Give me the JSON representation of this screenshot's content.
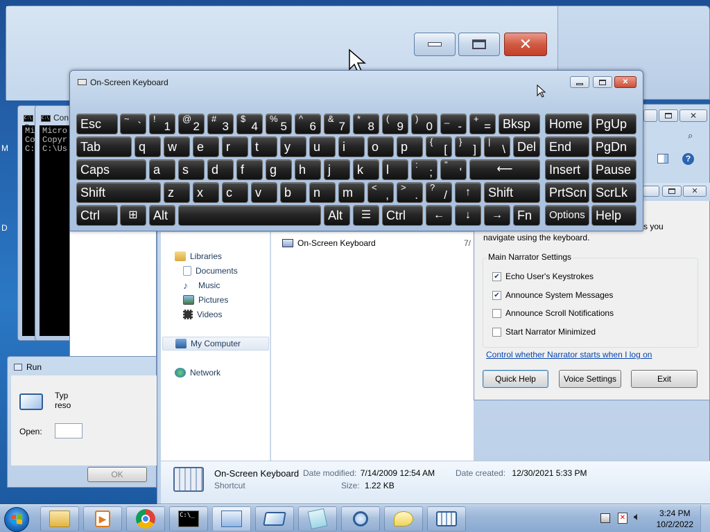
{
  "cmd_windows": [
    {
      "title": "Co",
      "lines": [
        "Mi",
        "Co",
        "",
        "C:"
      ]
    },
    {
      "title": "Con",
      "lines": [
        "Micro",
        "Copyr",
        "",
        "C:\\Us"
      ]
    }
  ],
  "on_screen_keyboard": {
    "title": "On-Screen Keyboard",
    "row1": [
      {
        "label": "Esc"
      },
      {
        "shift": "~",
        "base": "`"
      },
      {
        "shift": "!",
        "base": "1"
      },
      {
        "shift": "@",
        "base": "2"
      },
      {
        "shift": "#",
        "base": "3"
      },
      {
        "shift": "$",
        "base": "4"
      },
      {
        "shift": "%",
        "base": "5"
      },
      {
        "shift": "^",
        "base": "6"
      },
      {
        "shift": "&",
        "base": "7"
      },
      {
        "shift": "*",
        "base": "8"
      },
      {
        "shift": "(",
        "base": "9"
      },
      {
        "shift": ")",
        "base": "0"
      },
      {
        "shift": "_",
        "base": "-"
      },
      {
        "shift": "+",
        "base": "="
      },
      {
        "label": "Bksp"
      },
      {
        "label": "Home"
      },
      {
        "label": "PgUp"
      }
    ],
    "row2": [
      {
        "label": "Tab"
      },
      {
        "label": "q"
      },
      {
        "label": "w"
      },
      {
        "label": "e"
      },
      {
        "label": "r"
      },
      {
        "label": "t"
      },
      {
        "label": "y"
      },
      {
        "label": "u"
      },
      {
        "label": "i"
      },
      {
        "label": "o"
      },
      {
        "label": "p"
      },
      {
        "shift": "{",
        "base": "["
      },
      {
        "shift": "}",
        "base": "]"
      },
      {
        "shift": "|",
        "base": "\\"
      },
      {
        "label": "Del"
      },
      {
        "label": "End"
      },
      {
        "label": "PgDn"
      }
    ],
    "row3": [
      {
        "label": "Caps"
      },
      {
        "label": "a"
      },
      {
        "label": "s"
      },
      {
        "label": "d"
      },
      {
        "label": "f"
      },
      {
        "label": "g"
      },
      {
        "label": "h"
      },
      {
        "label": "j"
      },
      {
        "label": "k"
      },
      {
        "label": "l"
      },
      {
        "shift": ":",
        "base": ";"
      },
      {
        "shift": "\"",
        "base": "'"
      },
      {
        "label": "⟵"
      },
      {
        "label": "Insert"
      },
      {
        "label": "Pause"
      }
    ],
    "row4": [
      {
        "label": "Shift"
      },
      {
        "label": "z"
      },
      {
        "label": "x"
      },
      {
        "label": "c"
      },
      {
        "label": "v"
      },
      {
        "label": "b"
      },
      {
        "label": "n"
      },
      {
        "label": "m"
      },
      {
        "shift": "<",
        "base": ","
      },
      {
        "shift": ">",
        "base": "."
      },
      {
        "shift": "?",
        "base": "/"
      },
      {
        "label": "↑"
      },
      {
        "label": "Shift"
      },
      {
        "label": "PrtScn"
      },
      {
        "label": "ScrLk"
      }
    ],
    "row5": [
      {
        "label": "Ctrl"
      },
      {
        "label": "⊞"
      },
      {
        "label": "Alt"
      },
      {
        "label": ""
      },
      {
        "label": "Alt"
      },
      {
        "label": "☰"
      },
      {
        "label": "Ctrl"
      },
      {
        "label": "←"
      },
      {
        "label": "↓"
      },
      {
        "label": "→"
      },
      {
        "label": "Fn"
      },
      {
        "label": "Options"
      },
      {
        "label": "Help"
      }
    ]
  },
  "explorer": {
    "nav": {
      "libraries": "Libraries",
      "documents": "Documents",
      "music": "Music",
      "pictures": "Pictures",
      "videos": "Videos",
      "my_computer": "My Computer",
      "network": "Network"
    },
    "file_item": {
      "name": "On-Screen Keyboard",
      "date_fragment": "7/"
    },
    "details": {
      "name": "On-Screen Keyboard",
      "type": "Shortcut",
      "date_modified_label": "Date modified:",
      "date_modified": "7/14/2009 12:54 AM",
      "date_created_label": "Date created:",
      "date_created": "12/30/2021 5:33 PM",
      "size_label": "Size:",
      "size": "1.22 KB"
    }
  },
  "narrator": {
    "intro_fragment": "s you",
    "intro_line2": "navigate using the keyboard.",
    "group_title": "Main Narrator Settings",
    "options": [
      {
        "label": "Echo User's Keystrokes",
        "checked": true
      },
      {
        "label": "Announce System Messages",
        "checked": true
      },
      {
        "label": "Announce Scroll Notifications",
        "checked": false
      },
      {
        "label": "Start Narrator Minimized",
        "checked": false
      }
    ],
    "link": "Control whether Narrator starts when I log on",
    "buttons": {
      "quick_help": "Quick Help",
      "voice_settings": "Voice Settings",
      "exit": "Exit"
    }
  },
  "run_dialog": {
    "title": "Run",
    "text_line1": "Typ",
    "text_line2": "reso",
    "open_label": "Open:",
    "ok": "OK"
  },
  "left_edge_letters": [
    "M",
    "D"
  ],
  "taskbar": {
    "time": "3:24 PM",
    "date": "10/2/2022",
    "buttons": [
      "file-explorer",
      "media-player",
      "chrome",
      "command-prompt",
      "control-panel",
      "on-screen-keyboard",
      "notepad",
      "magnifier",
      "narrator",
      "osk-running"
    ]
  }
}
